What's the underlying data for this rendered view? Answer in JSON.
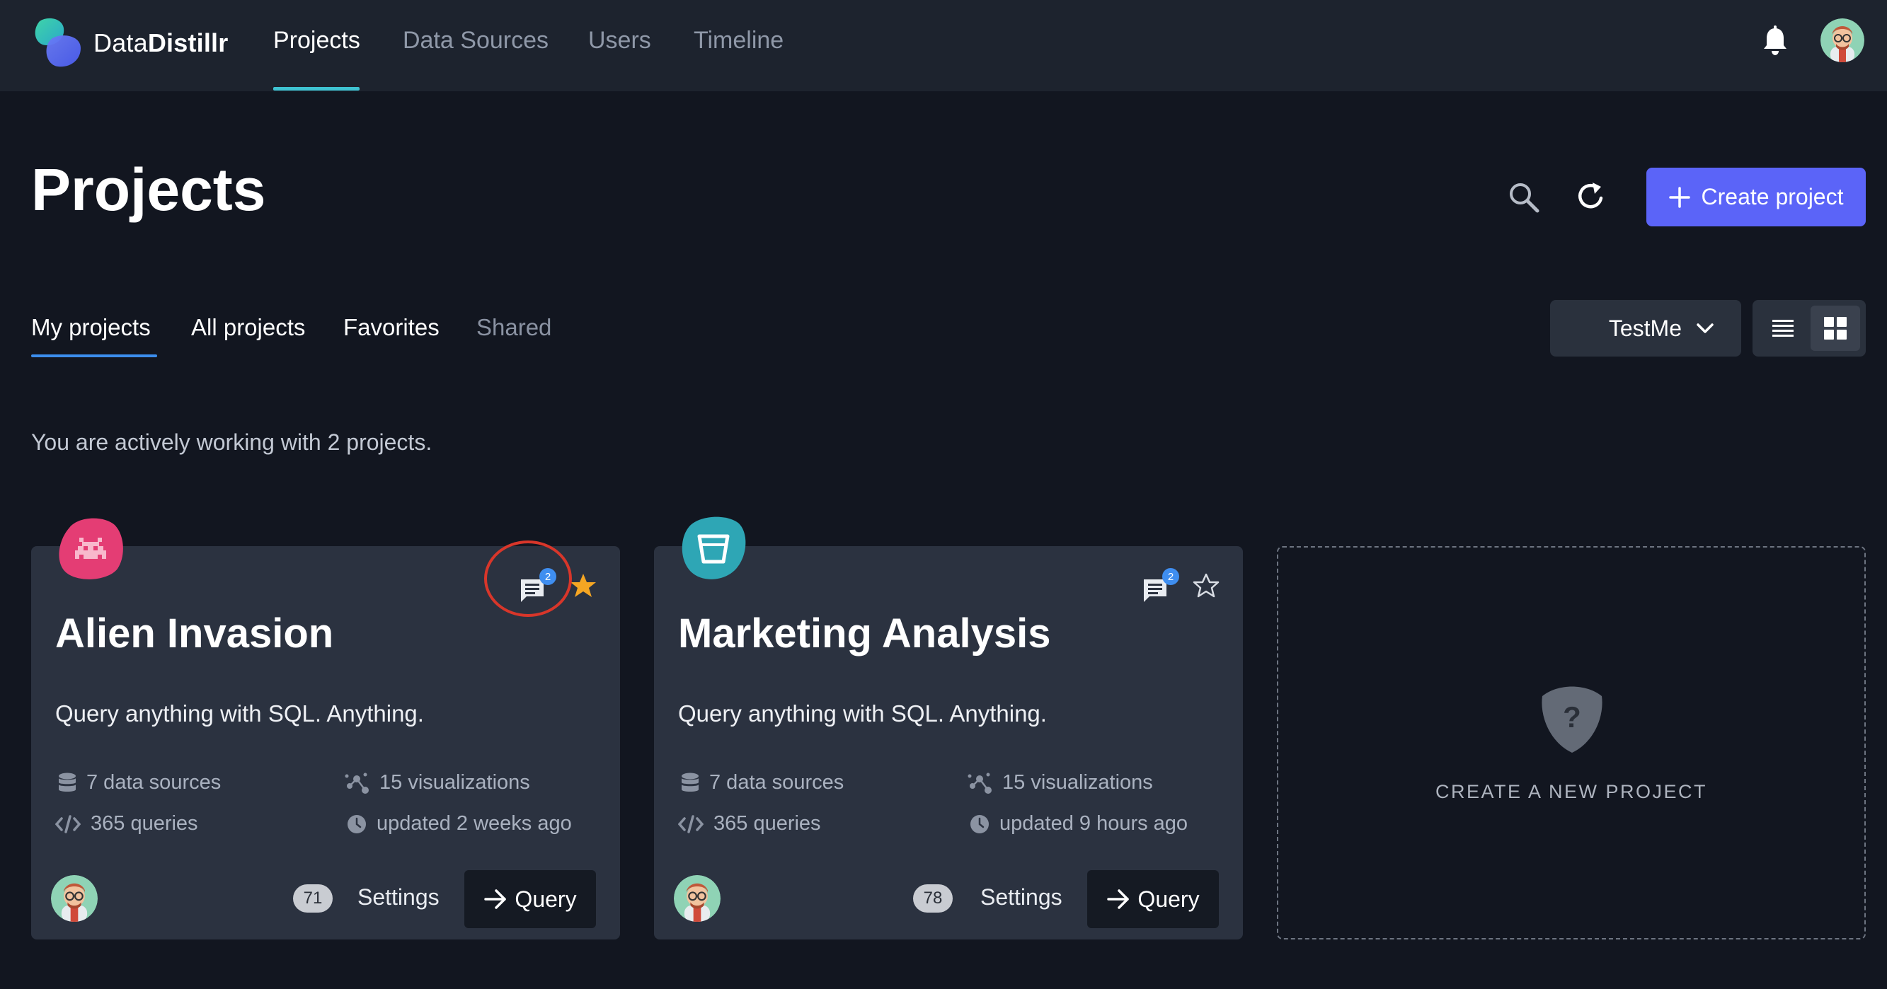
{
  "app": {
    "brand_prefix": "Data",
    "brand_bold": "Distillr"
  },
  "nav": {
    "items": [
      "Projects",
      "Data Sources",
      "Users",
      "Timeline"
    ],
    "active": "Projects"
  },
  "header": {
    "title": "Projects",
    "create_label": "Create project"
  },
  "tabs": {
    "items": [
      "My projects",
      "All projects",
      "Favorites",
      "Shared"
    ],
    "active": "My projects"
  },
  "workspace": {
    "selected": "TestMe"
  },
  "summary": "You are actively working with 2 projects.",
  "cards": [
    {
      "title": "Alien Invasion",
      "description": "Query anything with SQL. Anything.",
      "data_sources": "7 data sources",
      "queries": "365 queries",
      "visualizations": "15 visualizations",
      "updated": "updated 2 weeks ago",
      "comments": "2",
      "favorite": true,
      "count": "71",
      "settings_label": "Settings",
      "query_label": "Query",
      "icon": "alien-icon",
      "icon_color": "#e43d74"
    },
    {
      "title": "Marketing Analysis",
      "description": "Query anything with SQL. Anything.",
      "data_sources": "7 data sources",
      "queries": "365 queries",
      "visualizations": "15 visualizations",
      "updated": "updated 9 hours ago",
      "comments": "2",
      "favorite": false,
      "count": "78",
      "settings_label": "Settings",
      "query_label": "Query",
      "icon": "bucket-icon",
      "icon_color": "#2ea6b5"
    }
  ],
  "new_project": {
    "label": "CREATE A NEW PROJECT"
  },
  "colors": {
    "accent": "#5b64f8",
    "tab_underline": "#3c8eed",
    "nav_underline": "#3fc3d2",
    "star": "#f5a623",
    "highlight": "#d8362a"
  }
}
